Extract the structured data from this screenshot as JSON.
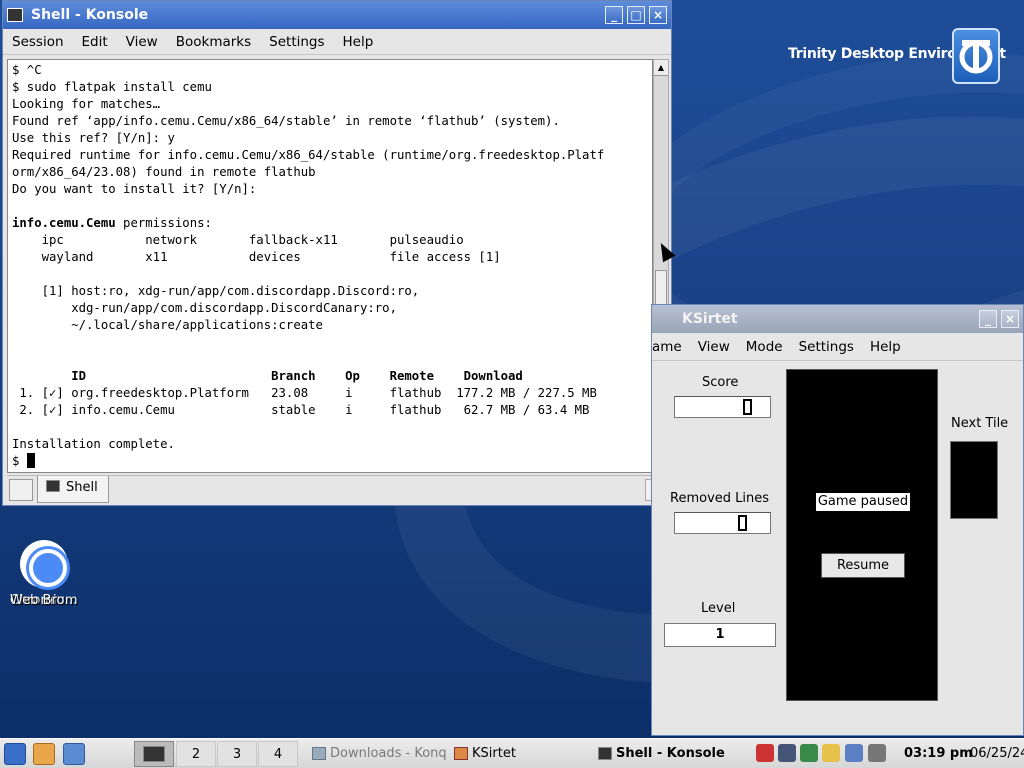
{
  "desktop": {
    "brand_text": "Trinity Desktop Environment",
    "icons": [
      {
        "label_line1": "Chromium",
        "label_line2": "Web Bro…"
      }
    ]
  },
  "konsole": {
    "title": "Shell - Konsole",
    "menu": [
      "Session",
      "Edit",
      "View",
      "Bookmarks",
      "Settings",
      "Help"
    ],
    "terminal_lines": [
      "$ ^C",
      "$ sudo flatpak install cemu",
      "Looking for matches…",
      "Found ref ‘app/info.cemu.Cemu/x86_64/stable’ in remote ‘flathub’ (system).",
      "Use this ref? [Y/n]: y",
      "Required runtime for info.cemu.Cemu/x86_64/stable (runtime/org.freedesktop.Platf",
      "orm/x86_64/23.08) found in remote flathub",
      "Do you want to install it? [Y/n]:",
      ""
    ],
    "permissions_app": "info.cemu.Cemu",
    "permissions_suffix": " permissions:",
    "permissions_rows": [
      "    ipc           network       fallback-x11       pulseaudio",
      "    wayland       x11           devices            file access [1]",
      "",
      "    [1] host:ro, xdg-run/app/com.discordapp.Discord:ro,",
      "        xdg-run/app/com.discordapp.DiscordCanary:ro,",
      "        ~/.local/share/applications:create",
      "",
      ""
    ],
    "table_header": "        ID                         Branch    Op    Remote    Download",
    "table_rows": [
      " 1. [✓] org.freedesktop.Platform   23.08     i     flathub  177.2 MB / 227.5 MB",
      " 2. [✓] info.cemu.Cemu             stable    i     flathub   62.7 MB / 63.4 MB"
    ],
    "after_lines": [
      "",
      "Installation complete."
    ],
    "prompt": "$ ",
    "tab_label": "Shell"
  },
  "ksirtet": {
    "title": "KSirtet",
    "menu": [
      "ame",
      "View",
      "Mode",
      "Settings",
      "Help"
    ],
    "score_label": "Score",
    "removed_lines_label": "Removed Lines",
    "level_label": "Level",
    "level_value": "1",
    "next_tile_label": "Next Tile",
    "paused_text": "Game paused",
    "resume_label": "Resume"
  },
  "taskbar": {
    "desktops": [
      "2",
      "3",
      "4"
    ],
    "tasks": [
      {
        "label": "Downloads - Konq"
      },
      {
        "label": "KSirtet"
      },
      {
        "label": "Shell - Konsole"
      }
    ],
    "clock": "03:19 pm",
    "date": "06/25/24"
  },
  "colors": {
    "titlebar_active": "#3668c2",
    "desktop_bg": "#1a448a"
  }
}
